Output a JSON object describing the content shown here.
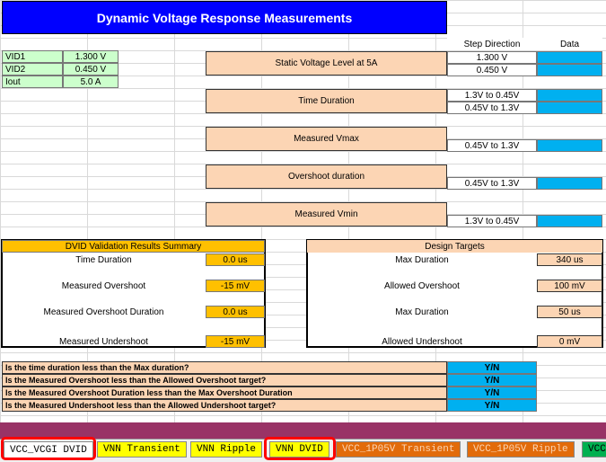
{
  "title": "Dynamic Voltage Response Measurements",
  "headers": {
    "step_direction": "Step Direction",
    "data": "Data"
  },
  "params": [
    {
      "name": "VID1",
      "value": "1.300 V"
    },
    {
      "name": "VID2",
      "value": "0.450 V"
    },
    {
      "name": "Iout",
      "value": "5.0 A"
    }
  ],
  "measurements": [
    {
      "label": "Static Voltage Level at 5A",
      "steps": [
        "1.300 V",
        "0.450 V"
      ]
    },
    {
      "label": "Time Duration",
      "steps": [
        "1.3V to 0.45V",
        "0.45V to 1.3V"
      ]
    },
    {
      "label": "Measured Vmax",
      "steps": [
        "0.45V to 1.3V"
      ]
    },
    {
      "label": "Overshoot duration",
      "steps": [
        "0.45V to 1.3V"
      ]
    },
    {
      "label": "Measured Vmin",
      "steps": [
        "1.3V to 0.45V"
      ]
    }
  ],
  "summary": {
    "title": "DVID Validation Results Summary",
    "rows": [
      {
        "label": "Time Duration",
        "value": "0.0 us"
      },
      {
        "label": "Measured Overshoot",
        "value": "-15 mV"
      },
      {
        "label": "Measured Overshoot Duration",
        "value": "0.0 us"
      },
      {
        "label": "Measured Undershoot",
        "value": "-15 mV"
      }
    ]
  },
  "targets": {
    "title": "Design Targets",
    "rows": [
      {
        "label": "Max Duration",
        "value": "340 us"
      },
      {
        "label": "Allowed Overshoot",
        "value": "100 mV"
      },
      {
        "label": "Max Duration",
        "value": "50 us"
      },
      {
        "label": "Allowed Undershoot",
        "value": "0 mV"
      }
    ]
  },
  "questions": [
    {
      "text": "Is the time duration less than the Max duration?",
      "answer": "Y/N"
    },
    {
      "text": "Is the Measured Overshoot less than the Allowed Overshoot target?",
      "answer": "Y/N"
    },
    {
      "text": "Is the Measured Overshoot Duration less than the Max Overshoot Duration",
      "answer": "Y/N"
    },
    {
      "text": "Is the Measured Undershoot less than the Allowed Undershoot target?",
      "answer": "Y/N"
    }
  ],
  "tabs": [
    "VCC_VCGI DVID",
    "VNN Transient",
    "VNN Ripple",
    "VNN DVID",
    "VCC_1P05V Transient",
    "VCC_1P05V Ripple",
    "VCC"
  ],
  "colors": {
    "title_bg": "#0000ff",
    "peach": "#fcd5b4",
    "cyan": "#00b0f0",
    "gold": "#ffc000",
    "green": "#ccffcc",
    "maroon": "#993366",
    "highlight_ring": "#ff0000"
  }
}
